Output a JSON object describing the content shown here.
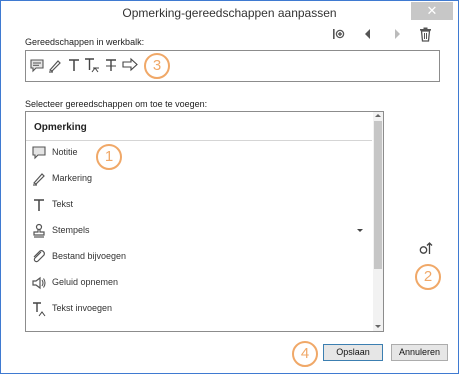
{
  "window": {
    "title": "Opmerking-gereedschappen aanpassen",
    "close_glyph": "✕"
  },
  "toolbar_section": {
    "label": "Gereedschappen in werkbalk:",
    "tools": [
      "comment-icon",
      "marker-icon",
      "text-t-icon",
      "replace-text-icon",
      "strike-text-icon",
      "arrow-icon"
    ],
    "action_icons": [
      "insert-separator-icon",
      "move-left-icon",
      "move-right-icon",
      "delete-icon"
    ]
  },
  "tools_section": {
    "label": "Selecteer gereedschappen om toe te voegen:",
    "header": "Opmerking",
    "items": [
      {
        "label": "Notitie",
        "icon": "note-icon"
      },
      {
        "label": "Markering",
        "icon": "marker-icon"
      },
      {
        "label": "Tekst",
        "icon": "text-icon"
      },
      {
        "label": "Stempels",
        "icon": "stamp-icon",
        "has_dropdown": true
      },
      {
        "label": "Bestand bijvoegen",
        "icon": "attach-file-icon"
      },
      {
        "label": "Geluid opnemen",
        "icon": "record-sound-icon"
      },
      {
        "label": "Tekst invoegen",
        "icon": "insert-text-icon"
      }
    ]
  },
  "buttons": {
    "save": "Opslaan",
    "cancel": "Annuleren"
  },
  "callouts": [
    "1",
    "2",
    "3",
    "4"
  ]
}
